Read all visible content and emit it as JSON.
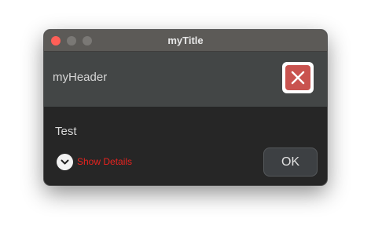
{
  "window": {
    "title": "myTitle"
  },
  "header": {
    "text": "myHeader",
    "graphic_icon": "close-x-icon"
  },
  "content": {
    "text": "Test"
  },
  "details": {
    "label": "Show Details",
    "icon": "chevron-down-icon"
  },
  "buttons": {
    "ok_label": "OK"
  },
  "colors": {
    "titlebar": "#5c5a57",
    "header_bg": "#434646",
    "content_bg": "#262626",
    "close_light": "#ff5f57",
    "graphic_red": "#c9534f",
    "details_text": "#e8231f",
    "ok_button_bg": "#3d4043"
  }
}
